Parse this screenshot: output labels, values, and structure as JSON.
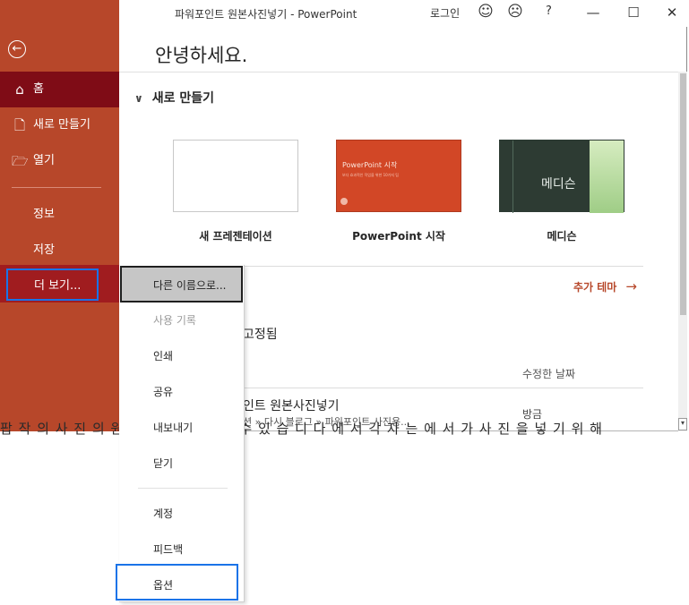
{
  "window": {
    "title": "파워포인트 원본사진넣기  -  PowerPoint",
    "login": "로그인",
    "smile_icon": "☺",
    "frown_icon": "☹",
    "help": "?",
    "minimize": "—",
    "maximize": "☐",
    "close": "✕"
  },
  "sidebar": {
    "back_icon": "←",
    "home": {
      "icon": "⌂",
      "label": "홈"
    },
    "new": {
      "icon": "🗋",
      "label": "새로 만들기"
    },
    "open": {
      "icon": "🗁",
      "label": "열기"
    },
    "info": "정보",
    "save": "저장",
    "more": "더 보기..."
  },
  "main": {
    "greeting": "안녕하세요.",
    "new_section": {
      "chevron": "∨",
      "title": "새로 만들기"
    },
    "templates": [
      {
        "label": "새 프레젠테이션"
      },
      {
        "label": "PowerPoint 시작",
        "thumb_title": "PowerPoint 시작",
        "thumb_sub": "보다 효과적인 작업을 위한 10가지 팁"
      },
      {
        "label": "메디슨",
        "thumb_title": "메디슨"
      }
    ],
    "more_themes": "추가 테마",
    "more_themes_arrow": "→",
    "pinned": "고정됨",
    "modified_header": "수정한 날짜",
    "recent_file": {
      "title": "인트 원본사진넣기",
      "path": "션 » 다시 블로그 » 파워포인트 사진용...",
      "time": "방금"
    }
  },
  "document_text": "팝 작 의 사 진 의 원 본 을 구 사 용 할 수 있 습 니 다 에 서 각 자 는 에 서 가 사 진 을 넣 기 위 해",
  "menu": {
    "save_as": "다른 이름으로...",
    "history": "사용 기록",
    "print": "인쇄",
    "share": "공유",
    "export": "내보내기",
    "close": "닫기",
    "account": "계정",
    "feedback": "피드백",
    "options": "옵션"
  },
  "colors": {
    "accent": "#b7472a",
    "selected_nav": "#7f0c16",
    "highlight": "#1a73e8"
  }
}
